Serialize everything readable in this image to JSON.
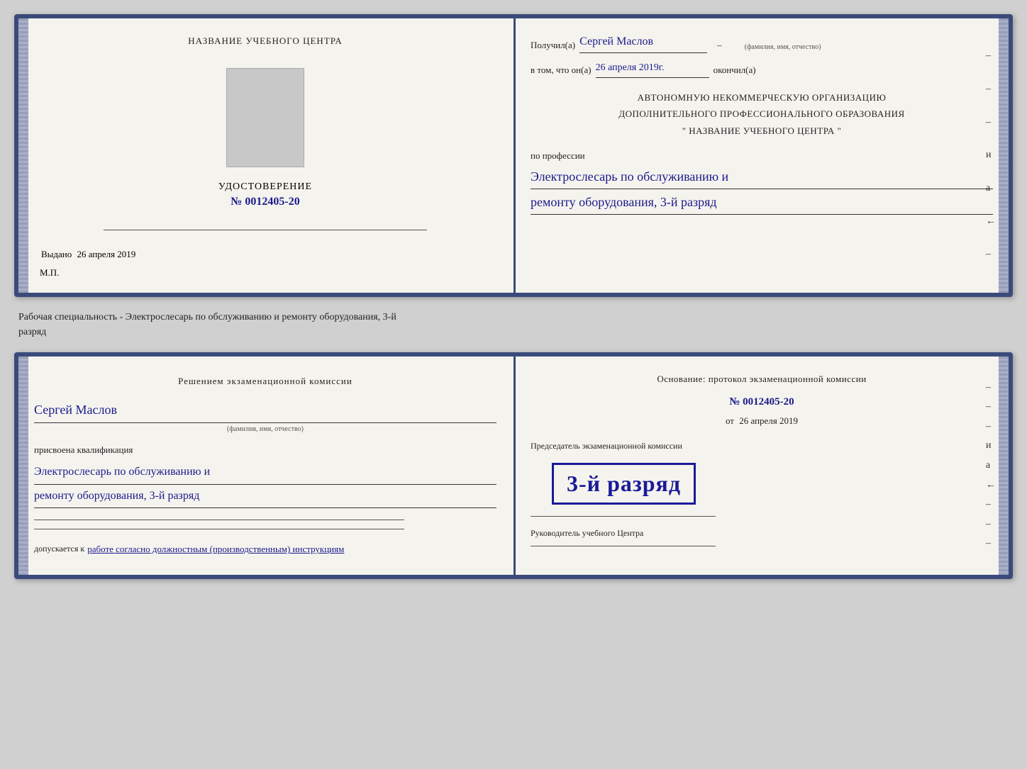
{
  "card1": {
    "left": {
      "center_title": "НАЗВАНИЕ УЧЕБНОГО ЦЕНТРА",
      "photo_alt": "Фото",
      "udostoverenie_label": "УДОСТОВЕРЕНИЕ",
      "number": "№ 0012405-20",
      "vydano_label": "Выдано",
      "vydano_date": "26 апреля 2019",
      "mp_label": "М.П."
    },
    "right": {
      "poluchil_label": "Получил(а)",
      "poluchil_name": "Сергей Маслов",
      "fio_note": "(фамилия, имя, отчество)",
      "vtom_label": "в том, что он(а)",
      "vtom_date": "26 апреля 2019г.",
      "okonchil_label": "окончил(а)",
      "org_line1": "АВТОНОМНУЮ НЕКОММЕРЧЕСКУЮ ОРГАНИЗАЦИЮ",
      "org_line2": "ДОПОЛНИТЕЛЬНОГО ПРОФЕССИОНАЛЬНОГО ОБРАЗОВАНИЯ",
      "org_line3": "\"  НАЗВАНИЕ УЧЕБНОГО ЦЕНТРА   \"",
      "po_professii_label": "по профессии",
      "profession_line1": "Электрослесарь по обслуживанию и",
      "profession_line2": "ремонту оборудования, 3-й разряд"
    }
  },
  "between": {
    "text_line1": "Рабочая специальность - Электрослесарь по обслуживанию и ремонту оборудования, 3-й",
    "text_line2": "разряд"
  },
  "card2": {
    "left": {
      "reshenie_title": "Решением  экзаменационной  комиссии",
      "name": "Сергей Маслов",
      "fio_note": "(фамилия, имя, отчество)",
      "prisvoena_label": "присвоена квалификация",
      "qual_line1": "Электрослесарь по обслуживанию и",
      "qual_line2": "ремонту оборудования, 3-й разряд",
      "dopuskaetsya_label": "допускается к",
      "dopuskaetsya_text": "работе согласно должностным (производственным) инструкциям"
    },
    "right": {
      "osnovanie_label": "Основание: протокол экзаменационной  комиссии",
      "protocol_number": "№  0012405-20",
      "ot_label": "от",
      "ot_date": "26 апреля 2019",
      "predsed_label": "Председатель экзаменационной комиссии",
      "stamp_text": "3-й разряд",
      "rukovod_label": "Руководитель учебного Центра"
    }
  },
  "dashes": [
    "–",
    "–",
    "–",
    "и",
    "а",
    "←",
    "–"
  ],
  "dashes2": [
    "–",
    "–",
    "–",
    "и",
    "а",
    "←",
    "–"
  ]
}
